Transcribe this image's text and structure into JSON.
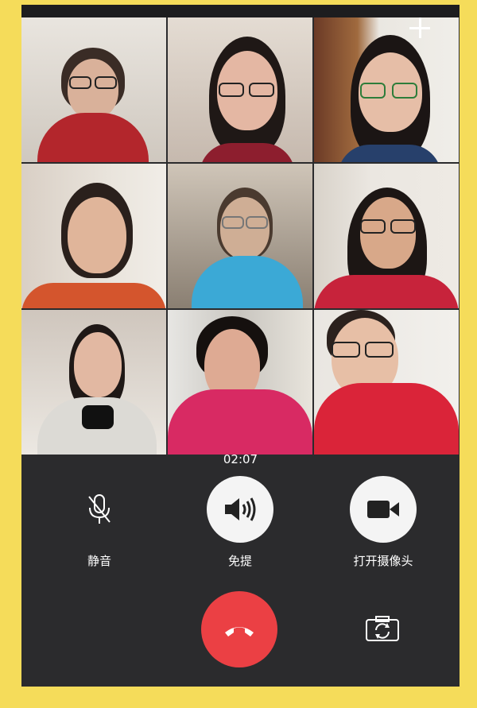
{
  "call": {
    "timer": "02:07",
    "controls": {
      "mute_label": "静音",
      "speaker_label": "免提",
      "camera_label": "打开摄像头"
    }
  },
  "participants": [
    {
      "id": "p1"
    },
    {
      "id": "p2"
    },
    {
      "id": "p3"
    },
    {
      "id": "p4"
    },
    {
      "id": "p5"
    },
    {
      "id": "p6"
    },
    {
      "id": "p7"
    },
    {
      "id": "p8"
    },
    {
      "id": "p9"
    }
  ],
  "icons": {
    "add": "plus-icon",
    "mute": "microphone-muted-icon",
    "speaker": "speaker-icon",
    "camera": "video-camera-icon",
    "hangup": "phone-hangup-icon",
    "switch_camera": "camera-switch-icon"
  },
  "colors": {
    "frame": "#f5dc5a",
    "panel": "#2b2b2d",
    "hangup": "#eb4044",
    "control_circle": "#f4f4f4"
  }
}
